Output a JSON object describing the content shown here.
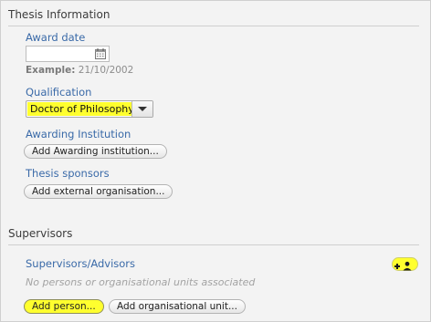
{
  "thesis_section": {
    "title": "Thesis Information",
    "award_date": {
      "label": "Award date",
      "value": "",
      "example_prefix": "Example:",
      "example_value": "21/10/2002"
    },
    "qualification": {
      "label": "Qualification",
      "selected": "Doctor of Philosophy"
    },
    "awarding_institution": {
      "label": "Awarding Institution",
      "button_label": "Add Awarding institution..."
    },
    "thesis_sponsors": {
      "label": "Thesis sponsors",
      "button_label": "Add external organisation..."
    }
  },
  "supervisors_section": {
    "title": "Supervisors",
    "label": "Supervisors/Advisors",
    "empty_text": "No persons or organisational units associated",
    "add_person_label": "Add person...",
    "add_unit_label": "Add organisational unit..."
  },
  "icons": {
    "calendar": "calendar-icon",
    "add_person": "add-person-icon",
    "dropdown": "chevron-down-icon"
  },
  "colors": {
    "highlight": "#ffff2e",
    "label_blue": "#3a6aa8"
  }
}
